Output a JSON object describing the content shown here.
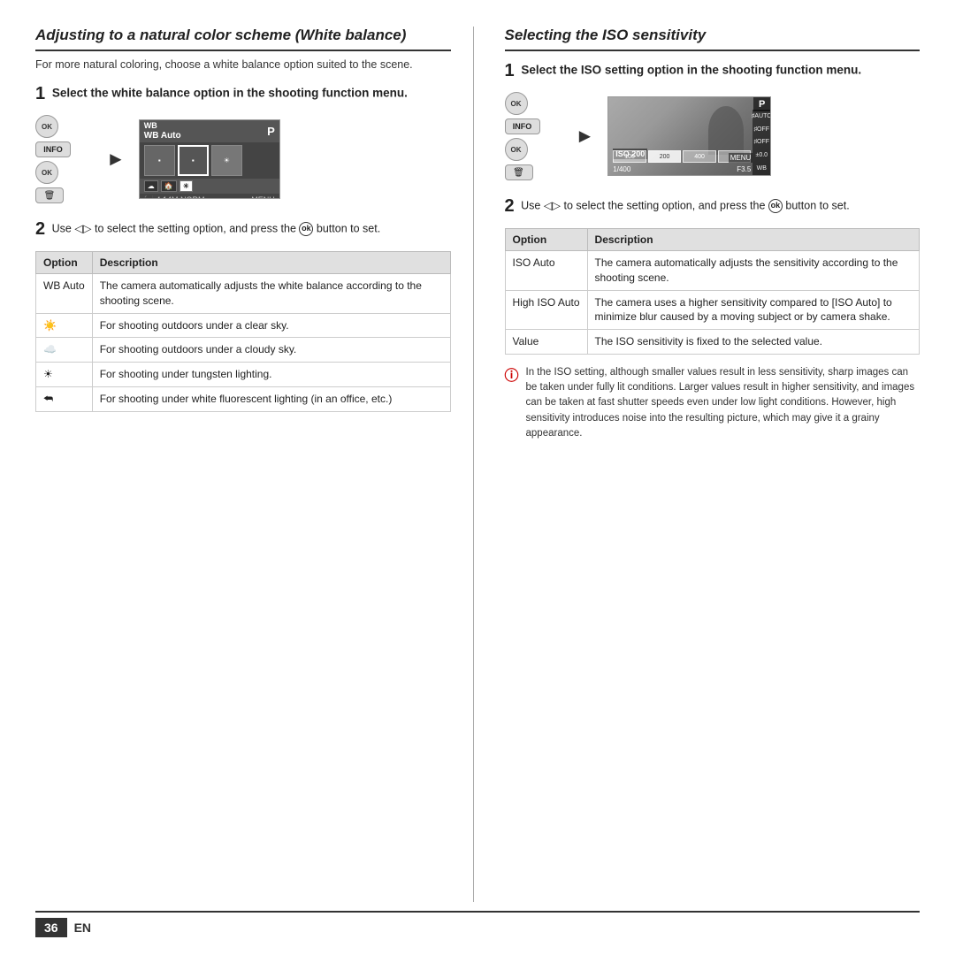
{
  "left_section": {
    "title": "Adjusting to a natural color scheme (White balance)",
    "intro": "For more natural coloring, choose a white balance option suited to the scene.",
    "step1_heading": "Select the white balance option in the shooting function menu.",
    "step2_text": "Use ◁▷ to select the setting option, and press the",
    "step2_text2": "button to set.",
    "ok_label": "ok",
    "table": {
      "col1": "Option",
      "col2": "Description",
      "rows": [
        {
          "option": "WB Auto",
          "description": "The camera automatically adjusts the white balance according to the shooting scene."
        },
        {
          "option": "☀️",
          "description": "For shooting outdoors under a clear sky."
        },
        {
          "option": "☁️",
          "description": "For shooting outdoors under a cloudy sky."
        },
        {
          "option": "☀",
          "description": "For shooting under tungsten lighting."
        },
        {
          "option": "⮪",
          "description": "For shooting under white fluorescent lighting (in an office, etc.)"
        }
      ]
    }
  },
  "right_section": {
    "title": "Selecting the ISO sensitivity",
    "step1_heading": "Select the ISO setting option in the shooting function menu.",
    "step2_text": "Use ◁▷ to select the setting option, and press the",
    "step2_text2": "button to set.",
    "ok_label": "ok",
    "table": {
      "col1": "Option",
      "col2": "Description",
      "rows": [
        {
          "option": "ISO Auto",
          "description": "The camera automatically adjusts the sensitivity according to the shooting scene."
        },
        {
          "option": "High ISO Auto",
          "description": "The camera uses a higher sensitivity compared to [ISO Auto] to minimize blur caused by a moving subject or by camera shake."
        },
        {
          "option": "Value",
          "description": "The ISO sensitivity is fixed to the selected value."
        }
      ]
    },
    "note": "In the ISO setting, although smaller values result in less sensitivity, sharp images can be taken under fully lit conditions. Larger values result in higher sensitivity, and images can be taken at fast shutter speeds even under low light conditions. However, high sensitivity introduces noise into the resulting picture, which may give it a grainy appearance."
  },
  "footer": {
    "page_number": "36",
    "language": "EN"
  }
}
